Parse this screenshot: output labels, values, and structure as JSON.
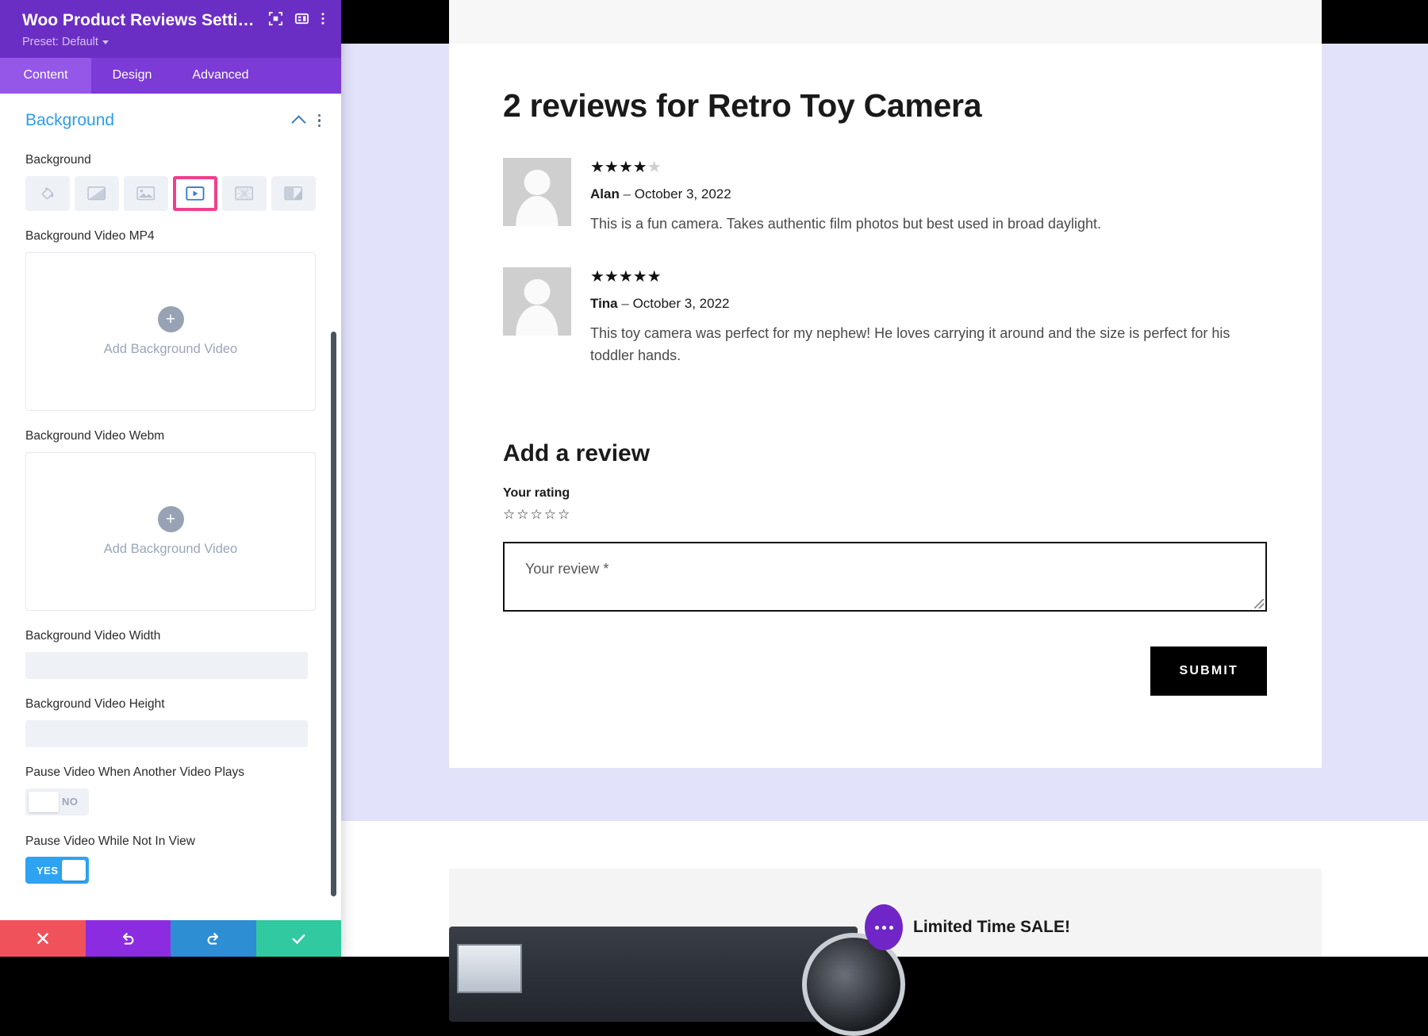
{
  "panel": {
    "title": "Woo Product Reviews Setti…",
    "preset": "Preset: Default",
    "header_icons": [
      "focus-frame-icon",
      "panel-layout-icon",
      "more-vertical-icon"
    ],
    "tabs": [
      {
        "label": "Content",
        "active": true
      },
      {
        "label": "Design",
        "active": false
      },
      {
        "label": "Advanced",
        "active": false
      }
    ],
    "section": {
      "title": "Background",
      "collapse_icon": "chevron-up-icon",
      "menu_icon": "more-vertical-icon"
    },
    "background_field_label": "Background",
    "background_types": [
      {
        "name": "color",
        "icon": "paint-bucket-icon",
        "selected": false
      },
      {
        "name": "gradient",
        "icon": "gradient-icon",
        "selected": false
      },
      {
        "name": "image",
        "icon": "image-icon",
        "selected": false
      },
      {
        "name": "video",
        "icon": "video-play-icon",
        "selected": true
      },
      {
        "name": "pattern",
        "icon": "pattern-icon",
        "selected": false
      },
      {
        "name": "mask",
        "icon": "mask-icon",
        "selected": false
      }
    ],
    "fields": {
      "mp4_label": "Background Video MP4",
      "mp4_cta": "Add Background Video",
      "webm_label": "Background Video Webm",
      "webm_cta": "Add Background Video",
      "width_label": "Background Video Width",
      "width_value": "",
      "height_label": "Background Video Height",
      "height_value": "",
      "pause_other_label": "Pause Video When Another Video Plays",
      "pause_other_value": "NO",
      "pause_notinview_label": "Pause Video While Not In View",
      "pause_notinview_value": "YES"
    },
    "footer": [
      {
        "name": "cancel-button",
        "icon": "close-icon",
        "color": "#f0525c"
      },
      {
        "name": "undo-button",
        "icon": "undo-icon",
        "color": "#8c2ce0"
      },
      {
        "name": "redo-button",
        "icon": "redo-icon",
        "color": "#2e8ed4"
      },
      {
        "name": "save-button",
        "icon": "check-icon",
        "color": "#30c9a0"
      }
    ],
    "accent_purple": "#6b2ec4",
    "accent_selected_pink": "#f0408c",
    "accent_blue": "#2e9ced"
  },
  "page": {
    "reviews_title": "2 reviews for Retro Toy Camera",
    "reviews": [
      {
        "rating": 4,
        "max_rating": 5,
        "name": "Alan",
        "separator": "–",
        "date": "October 3, 2022",
        "text": "This is a fun camera. Takes authentic film photos but best used in broad daylight."
      },
      {
        "rating": 5,
        "max_rating": 5,
        "name": "Tina",
        "separator": "–",
        "date": "October 3, 2022",
        "text": "This toy camera was perfect for my nephew! He loves carrying it around and the size is perfect for his toddler hands."
      }
    ],
    "add_review": {
      "heading": "Add a review",
      "rating_label": "Your rating",
      "rating_value": 0,
      "rating_max": 5,
      "textarea_placeholder": "Your review *",
      "textarea_value": "",
      "submit_label": "SUBMIT"
    },
    "promo": {
      "text": "Limited Time SALE!",
      "badge_icon": "ellipsis-badge-icon",
      "badge_color": "#7026c6"
    }
  }
}
